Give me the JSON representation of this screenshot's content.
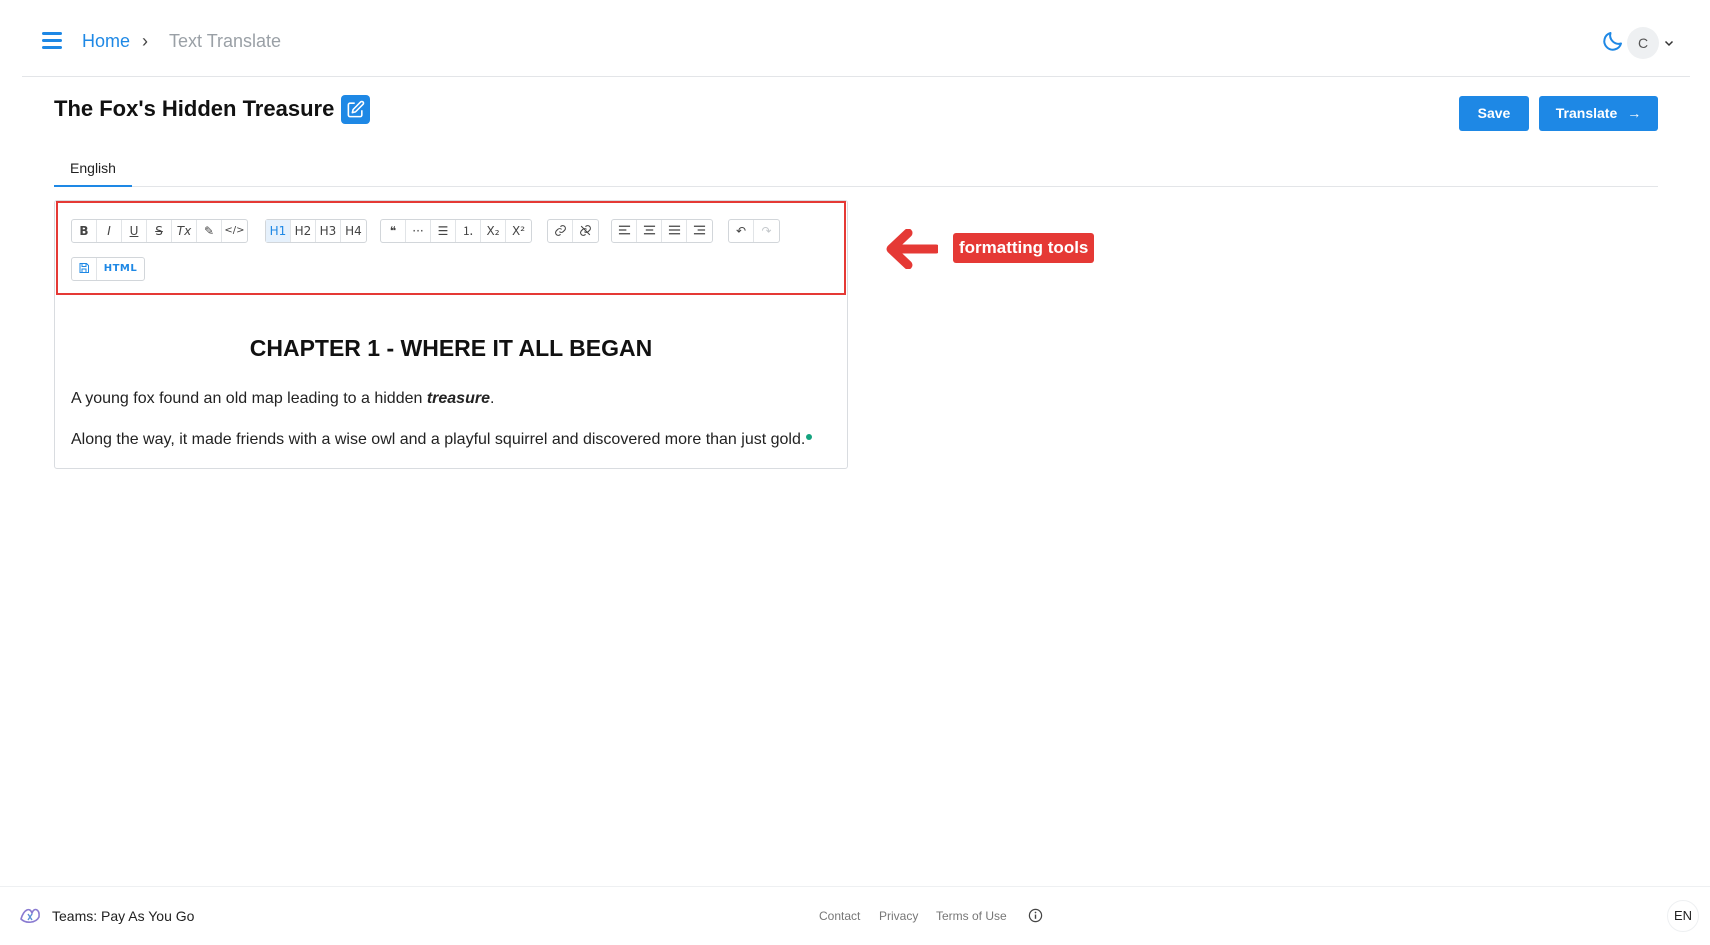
{
  "header": {
    "menu_icon": "hamburger-menu-icon",
    "breadcrumb_home": "Home",
    "breadcrumb_separator": "›",
    "breadcrumb_current": "Text Translate",
    "theme_icon": "moon-icon",
    "avatar_initial": "C"
  },
  "document": {
    "title": "The Fox's Hidden Treasure",
    "edit_icon": "edit-icon"
  },
  "actions": {
    "save_label": "Save",
    "translate_label": "Translate",
    "translate_arrow": "→"
  },
  "tabs": [
    {
      "label": "English",
      "active": true
    }
  ],
  "toolbar": {
    "row1_groups": [
      [
        "B",
        "I",
        "U",
        "S",
        "Tx",
        "✎",
        "</>"
      ],
      [
        "H1",
        "H2",
        "H3",
        "H4"
      ],
      [
        "❝",
        "···",
        "☰",
        "⒈",
        "X₂",
        "X²"
      ],
      [
        "🔗",
        "⛓"
      ],
      [
        "≡",
        "≡",
        "≡",
        "≡"
      ],
      [
        "↶",
        "↷"
      ]
    ],
    "row2": {
      "save_icon": "floppy-icon",
      "html_label": "HTML"
    }
  },
  "content": {
    "heading": "CHAPTER 1 - WHERE IT ALL BEGAN",
    "p1_before": "A young fox found an old map leading to a hidden ",
    "p1_emphasis": "treasure",
    "p1_after": ".",
    "p2": "Along the way, it made friends with a wise owl and a playful squirrel and discovered more than just gold."
  },
  "annotation": {
    "label": "formatting tools"
  },
  "footer": {
    "plan": "Teams: Pay As You Go",
    "contact": "Contact",
    "privacy": "Privacy",
    "terms": "Terms of Use",
    "language": "EN"
  },
  "colors": {
    "accent": "#1e88e5",
    "annotation_red": "#e53935",
    "cursor_green": "#14a37f"
  }
}
